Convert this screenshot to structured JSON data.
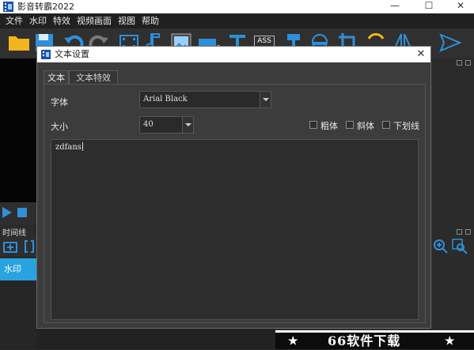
{
  "app": {
    "title": "影音转霸2022",
    "window_controls": {
      "minimize": "—",
      "maximize": "☐",
      "close": "✕"
    }
  },
  "menubar": {
    "items": [
      "文件",
      "水印",
      "特效",
      "视频画面",
      "视图",
      "帮助"
    ]
  },
  "toolbar": {
    "icons": [
      "folder-icon",
      "save-icon",
      "undo-icon",
      "redo-icon",
      "film-icon",
      "music-icon",
      "image-icon",
      "rectangle-icon",
      "text-icon",
      "subtitle-icon",
      "brush-icon",
      "mask-icon",
      "crop-icon",
      "rotate-icon",
      "mirror-icon",
      "send-icon"
    ],
    "subtitle_badge": "ASS"
  },
  "timeline": {
    "label": "时间线",
    "track_name": "水印"
  },
  "dialog": {
    "title": "文本设置",
    "close": "✕",
    "tabs": [
      {
        "label": "文本",
        "active": true
      },
      {
        "label": "文本特效",
        "active": false
      }
    ],
    "font_label": "字体",
    "font_value": "Arial Black",
    "size_label": "大小",
    "size_value": "40",
    "bold_label": "粗体",
    "italic_label": "斜体",
    "underline_label": "下划线",
    "bold_checked": false,
    "italic_checked": false,
    "underline_checked": false,
    "text_content": "zdfans"
  },
  "banner": {
    "text": "66软件下载",
    "star": "★"
  },
  "colors": {
    "accent_blue": "#29a3e0",
    "toolbar_bg": "#303030",
    "dialog_bg": "#3c3c3c",
    "icon_blue": "#2f8fd8",
    "icon_yellow": "#f2b51d"
  }
}
